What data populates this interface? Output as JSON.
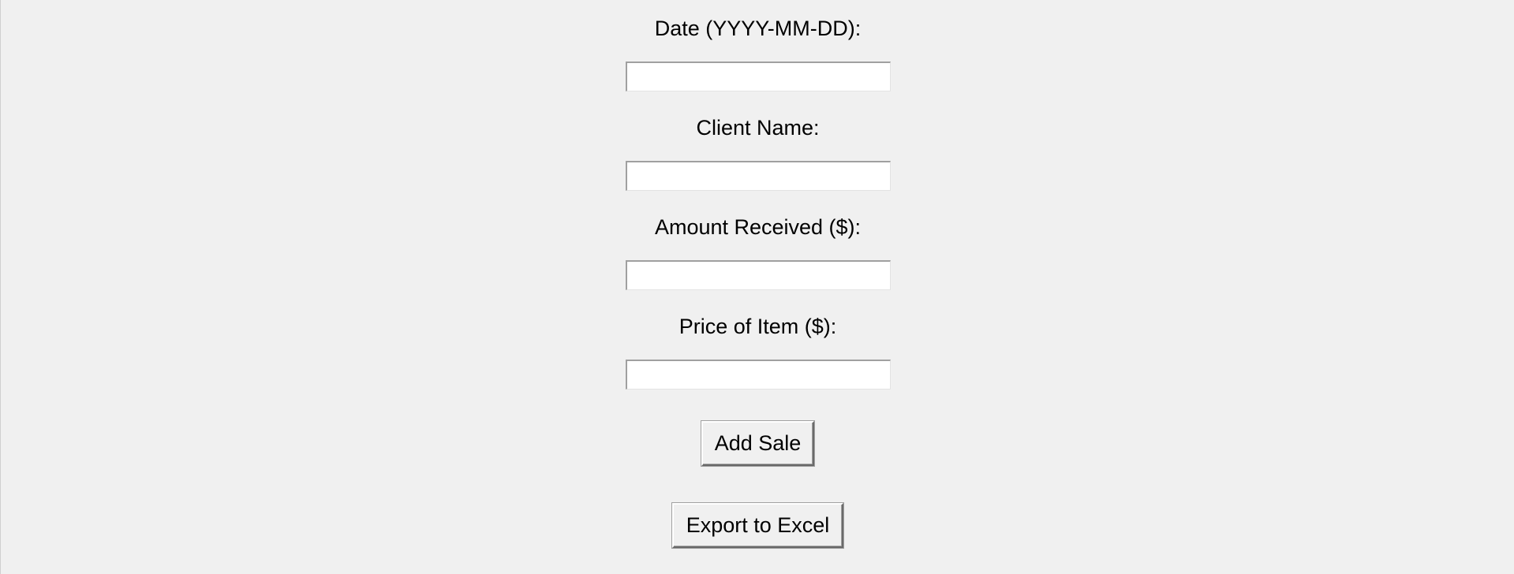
{
  "form": {
    "date_label": "Date (YYYY-MM-DD):",
    "date_value": "",
    "client_label": "Client Name:",
    "client_value": "",
    "amount_label": "Amount Received ($):",
    "amount_value": "",
    "price_label": "Price of Item ($):",
    "price_value": ""
  },
  "actions": {
    "add_sale_label": "Add Sale",
    "export_label": "Export to Excel"
  },
  "colors": {
    "background": "#f0f0f0",
    "entry_background": "#ffffff",
    "text": "#000000"
  }
}
